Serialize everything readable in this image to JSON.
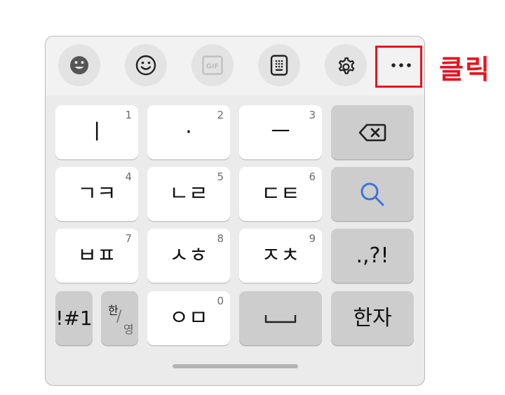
{
  "toolbar": {
    "buttons": [
      {
        "id": "sticker",
        "icon": "sticker-face-icon"
      },
      {
        "id": "emoji",
        "icon": "smiley-icon"
      },
      {
        "id": "gif",
        "icon": "gif-icon",
        "label": "GIF"
      },
      {
        "id": "clipboard",
        "icon": "keypad-icon"
      },
      {
        "id": "settings",
        "icon": "gear-icon"
      },
      {
        "id": "more",
        "icon": "more-dots-icon",
        "label": "···"
      }
    ]
  },
  "annotation": {
    "text": "클릭",
    "color": "#e8141c"
  },
  "keys": {
    "row1": [
      {
        "main": "ㅣ",
        "num": "1"
      },
      {
        "main": "·",
        "num": "2"
      },
      {
        "main": "ㅡ",
        "num": "3"
      },
      {
        "icon": "backspace-icon"
      }
    ],
    "row2": [
      {
        "main": "ㄱㅋ",
        "num": "4"
      },
      {
        "main": "ㄴㄹ",
        "num": "5"
      },
      {
        "main": "ㄷㅌ",
        "num": "6"
      },
      {
        "icon": "search-icon"
      }
    ],
    "row3": [
      {
        "main": "ㅂㅍ",
        "num": "7"
      },
      {
        "main": "ㅅㅎ",
        "num": "8"
      },
      {
        "main": "ㅈㅊ",
        "num": "9"
      },
      {
        "main": ".,?!"
      }
    ],
    "row4": {
      "symbols": "!#1",
      "lang_top": "한",
      "lang_slash": "/",
      "lang_bottom": "영",
      "oem": {
        "main": "ㅇㅁ",
        "num": "0"
      },
      "space_icon": "space-icon",
      "hanja": "한자"
    }
  },
  "colors": {
    "accent_blue": "#3b73d9",
    "annotation_red": "#e8141c"
  }
}
